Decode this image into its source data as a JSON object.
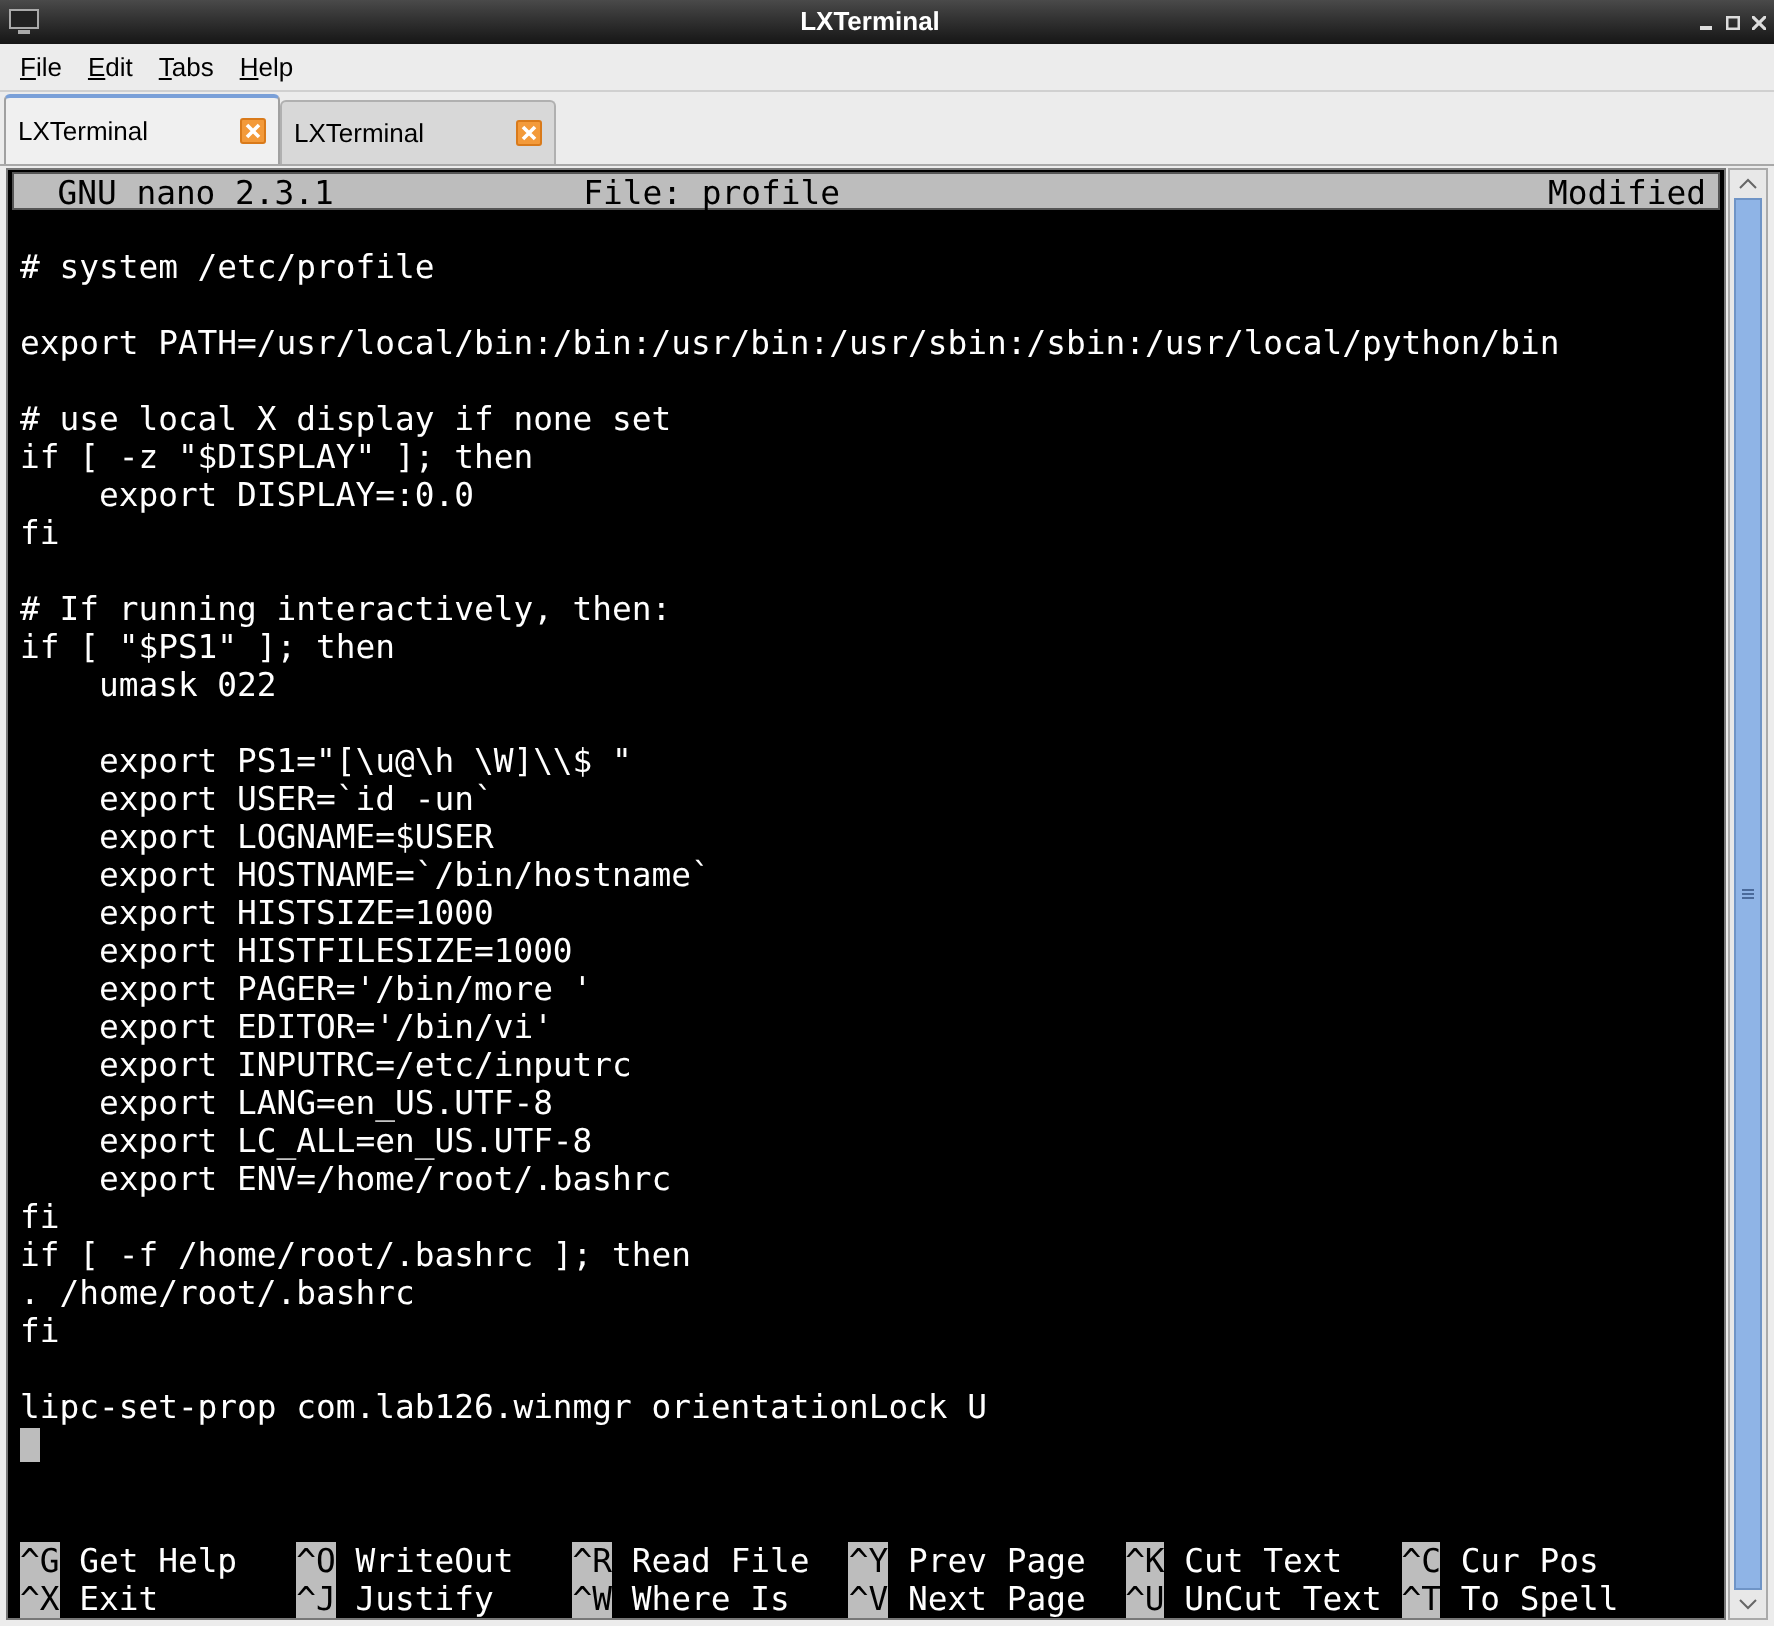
{
  "window": {
    "title": "LXTerminal"
  },
  "menu": [
    "File",
    "Edit",
    "Tabs",
    "Help"
  ],
  "tabs": [
    {
      "label": "LXTerminal",
      "selected": true
    },
    {
      "label": "LXTerminal",
      "selected": false
    }
  ],
  "nano": {
    "version": "GNU nano 2.3.1",
    "file": "File: profile",
    "status": "Modified",
    "blocks": [
      [
        "# system /etc/profile"
      ],
      [
        "export PATH=/usr/local/bin:/bin:/usr/bin:/usr/sbin:/sbin:/usr/local/python/bin"
      ],
      [
        "# use local X display if none set",
        "if [ -z \"$DISPLAY\" ]; then",
        "    export DISPLAY=:0.0",
        "fi"
      ],
      [
        "# If running interactively, then:",
        "if [ \"$PS1\" ]; then",
        "    umask 022"
      ],
      [
        "    export PS1=\"[\\u@\\h \\W]\\\\$ \"",
        "    export USER=`id -un`",
        "    export LOGNAME=$USER",
        "    export HOSTNAME=`/bin/hostname`",
        "    export HISTSIZE=1000",
        "    export HISTFILESIZE=1000",
        "    export PAGER='/bin/more '",
        "    export EDITOR='/bin/vi'",
        "    export INPUTRC=/etc/inputrc",
        "    export LANG=en_US.UTF-8",
        "    export LC_ALL=en_US.UTF-8",
        "    export ENV=/home/root/.bashrc",
        "fi",
        "if [ -f /home/root/.bashrc ]; then",
        ". /home/root/.bashrc",
        "fi"
      ],
      [
        "lipc-set-prop com.lab126.winmgr orientationLock U"
      ]
    ],
    "shortcuts": [
      [
        {
          "key": "^G",
          "label": "Get Help"
        },
        {
          "key": "^O",
          "label": "WriteOut"
        },
        {
          "key": "^R",
          "label": "Read File"
        },
        {
          "key": "^Y",
          "label": "Prev Page"
        },
        {
          "key": "^K",
          "label": "Cut Text"
        },
        {
          "key": "^C",
          "label": "Cur Pos"
        }
      ],
      [
        {
          "key": "^X",
          "label": "Exit"
        },
        {
          "key": "^J",
          "label": "Justify"
        },
        {
          "key": "^W",
          "label": "Where Is"
        },
        {
          "key": "^V",
          "label": "Next Page"
        },
        {
          "key": "^U",
          "label": "UnCut Text"
        },
        {
          "key": "^T",
          "label": "To Spell"
        }
      ]
    ]
  }
}
